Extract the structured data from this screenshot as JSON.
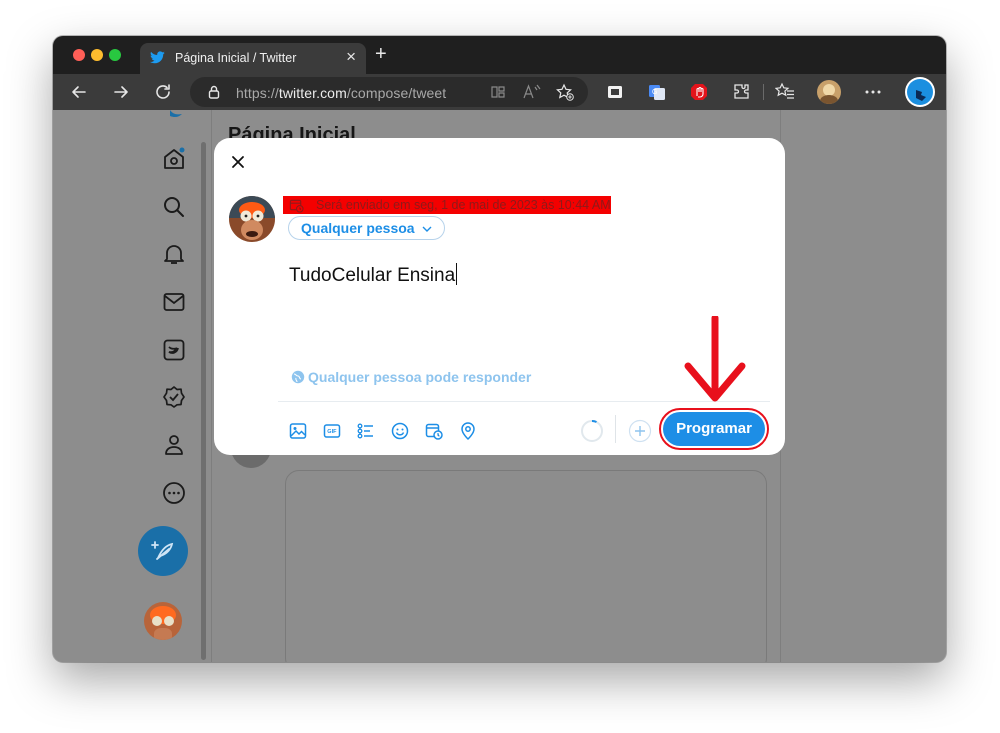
{
  "browser": {
    "tab_title": "Página Inicial / Twitter",
    "url_prefix": "https://",
    "url_domain": "twitter.com",
    "url_path": "/compose/tweet"
  },
  "page": {
    "title": "Página Inicial"
  },
  "compose": {
    "schedule_text": "Será enviado em seg, 1 de mai de 2023 às 10:44 AM",
    "audience_label": "Qualquer pessoa",
    "tweet_text": "TudoCelular Ensina",
    "reply_setting": "Qualquer pessoa pode responder",
    "submit_label": "Programar"
  },
  "colors": {
    "twitter_blue": "#1d8ee6",
    "highlight_red": "#f40000",
    "annotation_red": "#e8101c"
  },
  "icons": {
    "nav": [
      "home-icon",
      "search-icon",
      "notifications-icon",
      "messages-icon",
      "twitter-blue-icon",
      "verified-icon",
      "profile-icon",
      "more-icon"
    ],
    "composer_toolbar": [
      "image-icon",
      "gif-icon",
      "poll-icon",
      "emoji-icon",
      "schedule-icon",
      "location-icon"
    ]
  }
}
